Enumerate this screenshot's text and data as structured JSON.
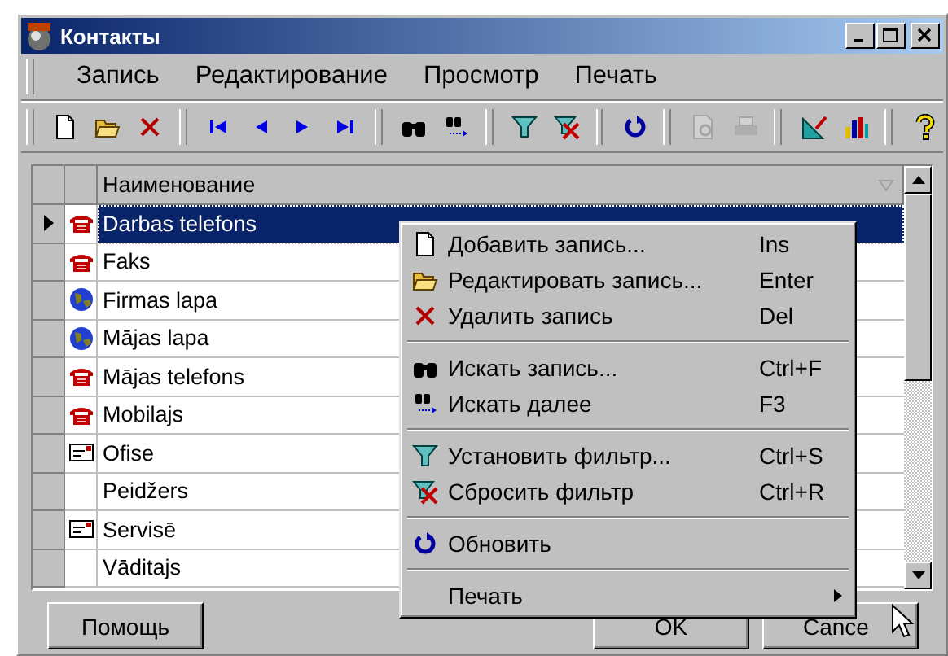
{
  "window": {
    "title": "Контакты"
  },
  "menu_bar": [
    "Запись",
    "Редактирование",
    "Просмотр",
    "Печать"
  ],
  "toolbar": [
    {
      "items": [
        {
          "kind": "new",
          "disabled": false
        },
        {
          "kind": "open",
          "disabled": false
        },
        {
          "kind": "delete",
          "disabled": false
        }
      ]
    },
    {
      "items": [
        {
          "kind": "first",
          "disabled": false
        },
        {
          "kind": "prev",
          "disabled": false
        },
        {
          "kind": "next",
          "disabled": false
        },
        {
          "kind": "last",
          "disabled": false
        }
      ]
    },
    {
      "items": [
        {
          "kind": "find",
          "disabled": false
        },
        {
          "kind": "find-next",
          "disabled": false
        }
      ]
    },
    {
      "items": [
        {
          "kind": "filter",
          "disabled": false
        },
        {
          "kind": "clear-filter",
          "disabled": false
        }
      ]
    },
    {
      "items": [
        {
          "kind": "refresh",
          "disabled": false
        }
      ]
    },
    {
      "items": [
        {
          "kind": "preview",
          "disabled": true
        },
        {
          "kind": "print",
          "disabled": true
        }
      ]
    },
    {
      "items": [
        {
          "kind": "design",
          "disabled": false
        },
        {
          "kind": "chart",
          "disabled": false
        }
      ]
    },
    {
      "items": [
        {
          "kind": "help",
          "disabled": false
        }
      ]
    }
  ],
  "table": {
    "columns": [
      "Наименование"
    ],
    "rows": [
      {
        "name": "Darbas telefons",
        "kind": "phone",
        "selected": true
      },
      {
        "name": "Faks",
        "kind": "phone",
        "selected": false
      },
      {
        "name": "Firmas lapa",
        "kind": "globe",
        "selected": false
      },
      {
        "name": "Mājas lapa",
        "kind": "globe",
        "selected": false
      },
      {
        "name": "Mājas telefons",
        "kind": "phone",
        "selected": false
      },
      {
        "name": "Mobilajs",
        "kind": "phone",
        "selected": false
      },
      {
        "name": "Ofise",
        "kind": "card",
        "selected": false
      },
      {
        "name": "Peidžers",
        "kind": "plain",
        "selected": false
      },
      {
        "name": "Servisē",
        "kind": "card",
        "selected": false
      },
      {
        "name": "Vāditajs",
        "kind": "plain",
        "selected": false
      }
    ]
  },
  "buttons": [
    "Помощь",
    "OK",
    "Cance"
  ],
  "context_menu": [
    {
      "kind": "new",
      "label": "Добавить запись...",
      "shortcut": "Ins"
    },
    {
      "kind": "open",
      "label": "Редактировать запись...",
      "shortcut": "Enter"
    },
    {
      "kind": "delete",
      "label": "Удалить запись",
      "shortcut": "Del"
    },
    {
      "kind": "separator"
    },
    {
      "kind": "find",
      "label": "Искать запись...",
      "shortcut": "Ctrl+F"
    },
    {
      "kind": "find-next",
      "label": "Искать далее",
      "shortcut": "F3"
    },
    {
      "kind": "separator"
    },
    {
      "kind": "filter",
      "label": "Установить фильтр...",
      "shortcut": "Ctrl+S"
    },
    {
      "kind": "clear-filter",
      "label": "Сбросить фильтр",
      "shortcut": "Ctrl+R"
    },
    {
      "kind": "separator"
    },
    {
      "kind": "refresh",
      "label": "Обновить"
    },
    {
      "kind": "separator"
    },
    {
      "kind": "submenu",
      "label": "Печать"
    }
  ]
}
